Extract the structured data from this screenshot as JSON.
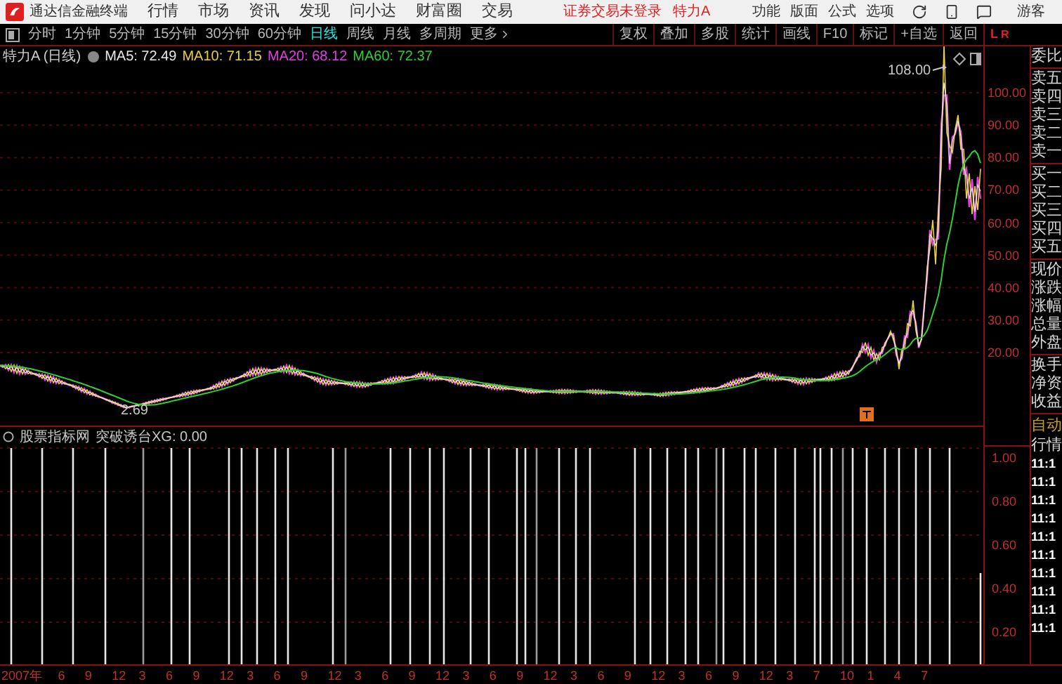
{
  "app": {
    "name": "通达信金融终端"
  },
  "menu": [
    "行情",
    "市场",
    "资讯",
    "发现",
    "问小达",
    "财富圈",
    "交易"
  ],
  "login_status": "证券交易未登录",
  "security": "特力A",
  "top_actions": [
    "功能",
    "版面",
    "公式",
    "选项"
  ],
  "user": "游客",
  "periods": [
    {
      "label": "分时",
      "selected": false
    },
    {
      "label": "1分钟",
      "selected": false
    },
    {
      "label": "5分钟",
      "selected": false
    },
    {
      "label": "15分钟",
      "selected": false
    },
    {
      "label": "30分钟",
      "selected": false
    },
    {
      "label": "60分钟",
      "selected": false
    },
    {
      "label": "日线",
      "selected": true
    },
    {
      "label": "周线",
      "selected": false
    },
    {
      "label": "月线",
      "selected": false
    },
    {
      "label": "多周期",
      "selected": false
    },
    {
      "label": "更多",
      "selected": false
    }
  ],
  "tools": [
    "复权",
    "叠加",
    "多股",
    "统计",
    "画线",
    "F10",
    "标记",
    "+自选",
    "返回"
  ],
  "corner_marks": [
    "L",
    "R"
  ],
  "chart": {
    "title": "特力A (日线)",
    "ma": [
      {
        "label": "MA5: 72.49",
        "color": "#e8e8e8"
      },
      {
        "label": "MA10: 71.15",
        "color": "#e8d040"
      },
      {
        "label": "MA20: 68.12",
        "color": "#e040e0"
      },
      {
        "label": "MA60: 72.37",
        "color": "#30d030"
      }
    ],
    "price_ticks": [
      "100.00",
      "90.00",
      "80.00",
      "70.00",
      "60.00",
      "50.00",
      "40.00",
      "30.00",
      "20.00"
    ],
    "high_label": "108.00",
    "low_label": "2.69"
  },
  "indicator": {
    "source": "股票指标网",
    "title": "突破诱台XG: 0.00",
    "ticks": [
      "1.00",
      "0.80",
      "0.60",
      "0.40",
      "0.20"
    ]
  },
  "date_axis": [
    "2007年",
    "6",
    "9",
    "12",
    "3",
    "6",
    "9",
    "12",
    "3",
    "6",
    "9",
    "12",
    "3",
    "6",
    "9",
    "12",
    "3",
    "6",
    "9",
    "12",
    "3",
    "6",
    "9",
    "12",
    "3",
    "6",
    "9",
    "12",
    "3",
    "7",
    "10",
    "1",
    "4",
    "7"
  ],
  "quote_panel": {
    "groups": [
      [
        "委比"
      ],
      [
        "卖五",
        "卖四",
        "卖三",
        "卖二",
        "卖一"
      ],
      [
        "买一",
        "买二",
        "买三",
        "买四",
        "买五"
      ],
      [
        "现价",
        "涨跌",
        "涨幅",
        "总量",
        "外盘"
      ],
      [
        "换手",
        "净资",
        "收益"
      ]
    ],
    "auto": "自动",
    "quote": "行情",
    "trades": [
      "11:1",
      "11:1",
      "11:1",
      "11:1",
      "11:1",
      "11:1",
      "11:1",
      "11:1",
      "11:1",
      "11:1"
    ]
  }
}
